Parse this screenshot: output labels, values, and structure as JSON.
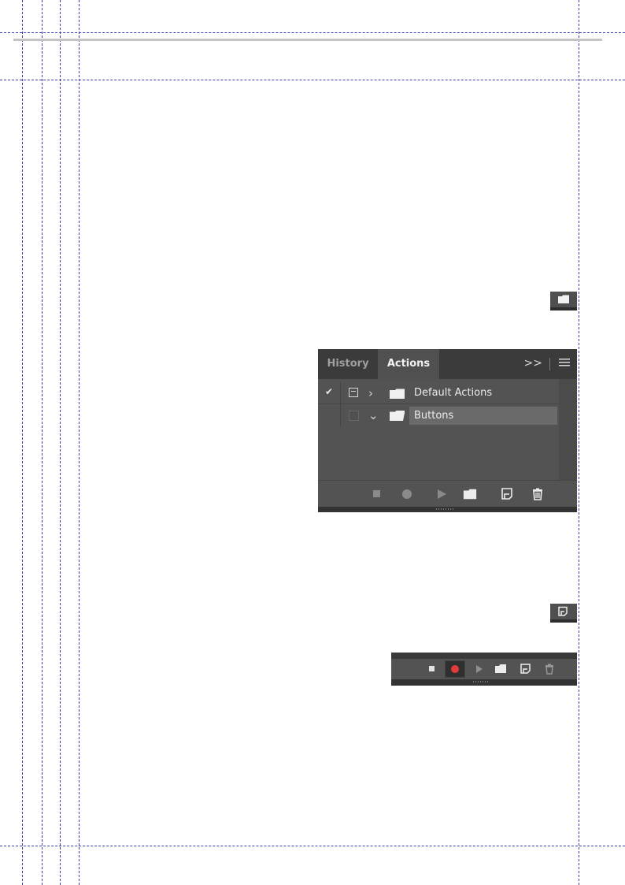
{
  "actions_panel": {
    "tabs": [
      {
        "label": "History"
      },
      {
        "label": "Actions"
      }
    ],
    "collapse_label": ">>",
    "rows": [
      {
        "label": "Default Actions"
      },
      {
        "label": "Buttons"
      }
    ]
  },
  "icons": {
    "top_small": "folder-icon",
    "bottom_small": "new-action-icon"
  },
  "colors": {
    "record_red": "#e53b3b"
  }
}
